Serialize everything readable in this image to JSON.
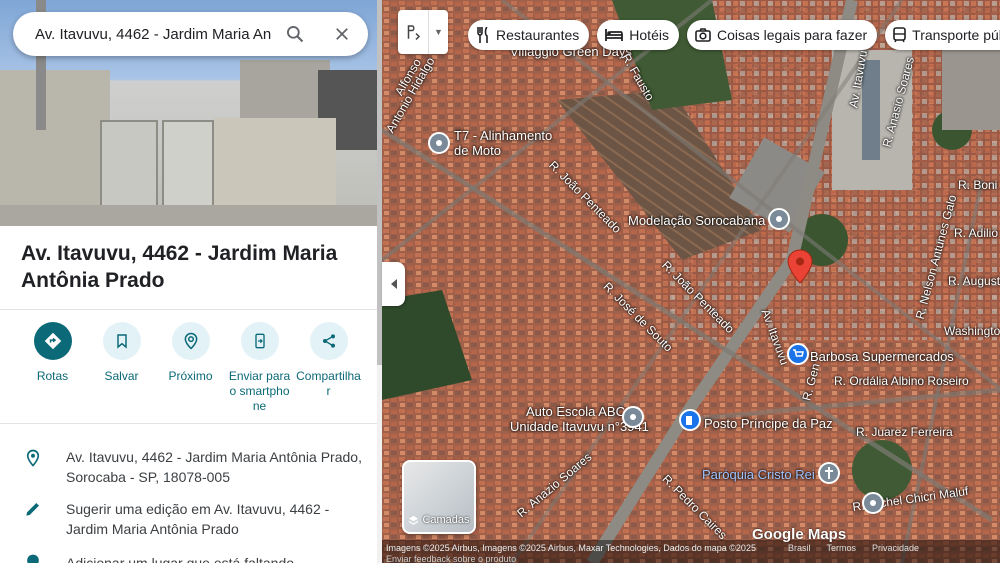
{
  "search": {
    "value": "Av. Itavuvu, 4462 - Jardim Maria Antônia Prado",
    "search_icon": "search-icon",
    "close_icon": "close-icon"
  },
  "place": {
    "title": "Av. Itavuvu, 4462 - Jardim Maria Antônia Prado"
  },
  "actions": [
    {
      "label": "Rotas",
      "icon": "directions-icon"
    },
    {
      "label": "Salvar",
      "icon": "bookmark-icon"
    },
    {
      "label": "Próximo",
      "icon": "nearby-icon"
    },
    {
      "label": "Enviar para o smartphone",
      "icon": "send-to-phone-icon"
    },
    {
      "label": "Compartilhar",
      "icon": "share-icon"
    }
  ],
  "info": [
    {
      "text": "Av. Itavuvu, 4462 - Jardim Maria Antônia Prado, Sorocaba - SP, 18078-005",
      "icon": "location-pin-icon"
    },
    {
      "text": "Sugerir uma edição em Av. Itavuvu, 4462 - Jardim Maria Antônia Prado",
      "icon": "edit-pencil-icon"
    },
    {
      "text": "Adicionar um lugar que está faltando",
      "icon": "add-place-icon"
    }
  ],
  "map": {
    "chips": [
      {
        "label": "Restaurantes",
        "icon": "restaurant-icon"
      },
      {
        "label": "Hotéis",
        "icon": "hotel-icon"
      },
      {
        "label": "Coisas legais para fazer",
        "icon": "camera-icon"
      },
      {
        "label": "Transporte púb",
        "icon": "transit-icon"
      }
    ],
    "labels": {
      "villaggio": "Villaggio Green Days",
      "t7_line1": "T7 - Alinhamento",
      "t7_line2": "de Moto",
      "modelacao": "Modelação Sorocabana",
      "barbosa": "Barbosa Supermercados",
      "autoescola_line1": "Auto Escola ABC -",
      "autoescola_line2": "Unidade Itavuvu n°3941",
      "posto": "Posto Príncipe da Paz",
      "paroquia": "Paróquia Cristo Rei",
      "r_joao_penteado1": "R. João Penteado",
      "r_joao_penteado2": "R. João Penteado",
      "r_jose_souto": "R. José de Souto",
      "av_itavuvu": "Av. Itavuvu",
      "av_itavuvu2": "Av. Itavuvu",
      "r_antonio_hidalgo": "Antonio Hidalgo",
      "r_anasio_soares": "R. Anasio Soares",
      "r_nelson_antunes": "R. Nelson Antunes Galo",
      "r_bon": "R. Boni",
      "r_adilio": "R. Adilio",
      "r_augusto": "R. Augusto",
      "washington": "Washington",
      "r_ordalia": "R. Ordália Albino Roseiro",
      "r_juarez": "R. Juarez Ferreira",
      "r_michel": "R. Michel Chicri Maluf",
      "r_pedro_caires": "R. Pedro Caires",
      "r_anazio": "R. Anazio Soares",
      "r_gen": "R. Gen",
      "r_fausto": "R. Fausto",
      "alfonso": "Alfonso"
    },
    "layers_label": "Camadas",
    "google_logo": "Google Maps",
    "attribution": "Imagens ©2025 Airbus, Imagens ©2025 Airbus, Maxar Technologies, Dados do mapa ©2025",
    "footer_links": [
      "Brasil",
      "Termos",
      "Privacidade"
    ],
    "feedback": "Enviar feedback sobre o produto"
  },
  "colors": {
    "accent": "#0b6978",
    "pin": "#ea4335"
  }
}
